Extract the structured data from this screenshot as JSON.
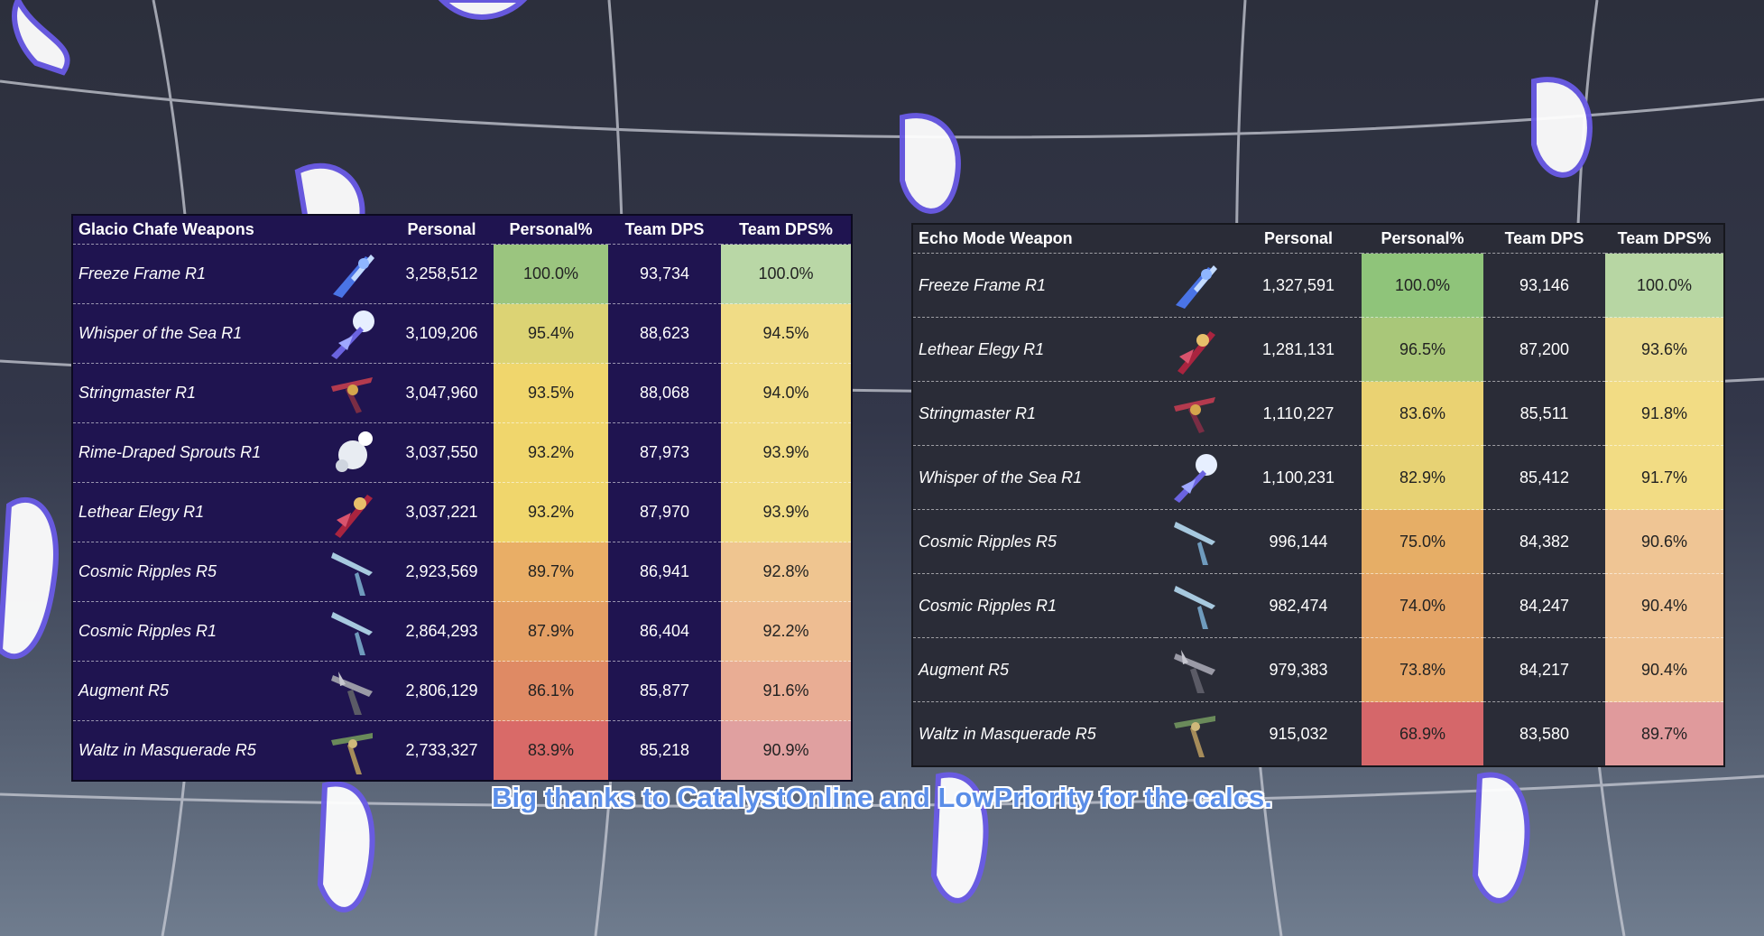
{
  "colors": {
    "green": "#9bc57f",
    "lightgreen": "#b9d7a6",
    "yellow": "#f2da72",
    "orange": "#e9ab68",
    "red": "#d96a68",
    "table1_bg": "#1f1450",
    "table2_bg": "#2a2c37",
    "caption": "#5b8ee8"
  },
  "caption": "Big thanks to CatalystOnline and LowPriority for the calcs.",
  "table1": {
    "headers": [
      "Glacio Chafe Weapons",
      "Personal",
      "Personal%",
      "Team DPS",
      "Team DPS%"
    ],
    "rows": [
      {
        "weapon": "Freeze Frame R1",
        "icon": "freeze-frame-icon",
        "personal": "3,258,512",
        "personal_pct": "100.0%",
        "team_dps": "93,734",
        "team_pct": "100.0%",
        "pc": "#9bc57f",
        "tc": "#b9d7a6"
      },
      {
        "weapon": "Whisper of the Sea R1",
        "icon": "whisper-of-the-sea-icon",
        "personal": "3,109,206",
        "personal_pct": "95.4%",
        "team_dps": "88,623",
        "team_pct": "94.5%",
        "pc": "#dcd374",
        "tc": "#f0dc86"
      },
      {
        "weapon": "Stringmaster R1",
        "icon": "stringmaster-icon",
        "personal": "3,047,960",
        "personal_pct": "93.5%",
        "team_dps": "88,068",
        "team_pct": "94.0%",
        "pc": "#f0d66c",
        "tc": "#f1dc84"
      },
      {
        "weapon": "Rime-Draped Sprouts R1",
        "icon": "rime-draped-sprouts-icon",
        "personal": "3,037,550",
        "personal_pct": "93.2%",
        "team_dps": "87,973",
        "team_pct": "93.9%",
        "pc": "#f0d66c",
        "tc": "#f1dc84"
      },
      {
        "weapon": "Lethear Elegy R1",
        "icon": "lethear-elegy-icon",
        "personal": "3,037,221",
        "personal_pct": "93.2%",
        "team_dps": "87,970",
        "team_pct": "93.9%",
        "pc": "#f0d66c",
        "tc": "#f1dc84"
      },
      {
        "weapon": "Cosmic Ripples R5",
        "icon": "cosmic-ripples-icon",
        "personal": "2,923,569",
        "personal_pct": "89.7%",
        "team_dps": "86,941",
        "team_pct": "92.8%",
        "pc": "#e9ae66",
        "tc": "#efc590"
      },
      {
        "weapon": "Cosmic Ripples R1",
        "icon": "cosmic-ripples-icon",
        "personal": "2,864,293",
        "personal_pct": "87.9%",
        "team_dps": "86,404",
        "team_pct": "92.2%",
        "pc": "#e49f64",
        "tc": "#eebd92"
      },
      {
        "weapon": "Augment R5",
        "icon": "augment-icon",
        "personal": "2,806,129",
        "personal_pct": "86.1%",
        "team_dps": "85,877",
        "team_pct": "91.6%",
        "pc": "#df8a64",
        "tc": "#e9ad94"
      },
      {
        "weapon": "Waltz in Masquerade R5",
        "icon": "waltz-in-masquerade-icon",
        "personal": "2,733,327",
        "personal_pct": "83.9%",
        "team_dps": "85,218",
        "team_pct": "90.9%",
        "pc": "#d96a68",
        "tc": "#e0a0a0"
      }
    ]
  },
  "table2": {
    "headers": [
      "Echo Mode Weapon",
      "Personal",
      "Personal%",
      "Team DPS",
      "Team DPS%"
    ],
    "rows": [
      {
        "weapon": "Freeze Frame R1",
        "icon": "freeze-frame-icon",
        "personal": "1,327,591",
        "personal_pct": "100.0%",
        "team_dps": "93,146",
        "team_pct": "100.0%",
        "pc": "#8fc47a",
        "tc": "#b7d6a3"
      },
      {
        "weapon": "Lethear Elegy R1",
        "icon": "lethear-elegy-icon",
        "personal": "1,281,131",
        "personal_pct": "96.5%",
        "team_dps": "87,200",
        "team_pct": "93.6%",
        "pc": "#a9c779",
        "tc": "#ecdb8e"
      },
      {
        "weapon": "Stringmaster R1",
        "icon": "stringmaster-icon",
        "personal": "1,110,227",
        "personal_pct": "83.6%",
        "team_dps": "85,511",
        "team_pct": "91.8%",
        "pc": "#ead272",
        "tc": "#f2dc84"
      },
      {
        "weapon": "Whisper of the Sea R1",
        "icon": "whisper-of-the-sea-icon",
        "personal": "1,100,231",
        "personal_pct": "82.9%",
        "team_dps": "85,412",
        "team_pct": "91.7%",
        "pc": "#e7d274",
        "tc": "#f2dc84"
      },
      {
        "weapon": "Cosmic Ripples R5",
        "icon": "cosmic-ripples-icon",
        "personal": "996,144",
        "personal_pct": "75.0%",
        "team_dps": "84,382",
        "team_pct": "90.6%",
        "pc": "#e6ae66",
        "tc": "#efc594"
      },
      {
        "weapon": "Cosmic Ripples R1",
        "icon": "cosmic-ripples-icon",
        "personal": "982,474",
        "personal_pct": "74.0%",
        "team_dps": "84,247",
        "team_pct": "90.4%",
        "pc": "#e4a466",
        "tc": "#efc394"
      },
      {
        "weapon": "Augment R5",
        "icon": "augment-icon",
        "personal": "979,383",
        "personal_pct": "73.8%",
        "team_dps": "84,217",
        "team_pct": "90.4%",
        "pc": "#e4a466",
        "tc": "#efc394"
      },
      {
        "weapon": "Waltz in Masquerade R5",
        "icon": "waltz-in-masquerade-icon",
        "personal": "915,032",
        "personal_pct": "68.9%",
        "team_dps": "83,580",
        "team_pct": "89.7%",
        "pc": "#d5676a",
        "tc": "#e09a9c"
      }
    ]
  }
}
